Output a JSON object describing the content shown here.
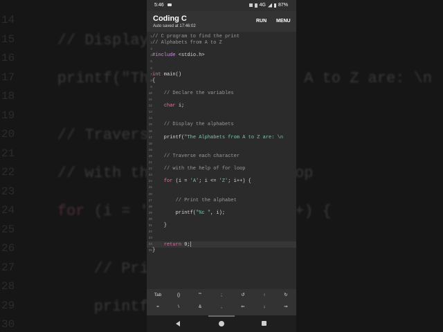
{
  "status_bar": {
    "time": "5:46",
    "network": "4G",
    "battery": "87%"
  },
  "app": {
    "title": "Coding C",
    "autosave": "Auto saved at 17:46:02",
    "run_label": "RUN",
    "menu_label": "MENU"
  },
  "editor": {
    "lines": [
      {
        "n": "1",
        "text": "// C program to find the print",
        "type": "comment"
      },
      {
        "n": "2",
        "text": "// Alphabets from A to Z",
        "type": "comment"
      },
      {
        "n": "3",
        "text": "",
        "type": "plain"
      },
      {
        "n": "4",
        "text": "#include <stdio.h>",
        "type": "include"
      },
      {
        "n": "5",
        "text": "",
        "type": "plain"
      },
      {
        "n": "6",
        "text": "",
        "type": "plain"
      },
      {
        "n": "7",
        "text": "int main()",
        "type": "main"
      },
      {
        "n": "8",
        "text": "{",
        "type": "plain"
      },
      {
        "n": "9",
        "text": "",
        "type": "plain"
      },
      {
        "n": "10",
        "text": "    // Declare the variables",
        "type": "comment"
      },
      {
        "n": "11",
        "text": "",
        "type": "plain"
      },
      {
        "n": "12",
        "text": "    char i;",
        "type": "decl"
      },
      {
        "n": "13",
        "text": "",
        "type": "plain"
      },
      {
        "n": "14",
        "text": "",
        "type": "plain"
      },
      {
        "n": "15",
        "text": "    // Display the alphabets",
        "type": "comment"
      },
      {
        "n": "16",
        "text": "",
        "type": "plain"
      },
      {
        "n": "17",
        "text": "    printf(\"The Alphabets from A to Z are: \\n",
        "type": "printf"
      },
      {
        "n": "18",
        "text": "",
        "type": "plain"
      },
      {
        "n": "19",
        "text": "",
        "type": "plain"
      },
      {
        "n": "20",
        "text": "    // Traverse each character",
        "type": "comment"
      },
      {
        "n": "21",
        "text": "",
        "type": "plain"
      },
      {
        "n": "22",
        "text": "    // with the help of for loop",
        "type": "comment"
      },
      {
        "n": "23",
        "text": "",
        "type": "plain"
      },
      {
        "n": "24",
        "text": "    for (i = 'A'; i <= 'Z'; i++) {",
        "type": "for"
      },
      {
        "n": "25",
        "text": "",
        "type": "plain"
      },
      {
        "n": "26",
        "text": "",
        "type": "plain"
      },
      {
        "n": "27",
        "text": "        // Print the alphabet",
        "type": "comment"
      },
      {
        "n": "28",
        "text": "",
        "type": "plain"
      },
      {
        "n": "29",
        "text": "        printf(\"%c \", i);",
        "type": "printf2"
      },
      {
        "n": "30",
        "text": "",
        "type": "plain"
      },
      {
        "n": "31",
        "text": "    }",
        "type": "plain"
      },
      {
        "n": "32",
        "text": "",
        "type": "plain"
      },
      {
        "n": "33",
        "text": "",
        "type": "plain"
      },
      {
        "n": "34",
        "text": "    return 0;",
        "type": "return"
      },
      {
        "n": "35",
        "text": "}",
        "type": "plain"
      }
    ],
    "active_line": "34"
  },
  "keys": [
    {
      "label": "Tab",
      "name": "key-tab"
    },
    {
      "label": "{}",
      "name": "key-braces"
    },
    {
      "label": "\"\"",
      "name": "key-quotes"
    },
    {
      "label": ";",
      "name": "key-semicolon"
    },
    {
      "label": "↺",
      "name": "key-undo"
    },
    {
      "label": "↑",
      "name": "key-up"
    },
    {
      "label": "↻",
      "name": "key-redo"
    },
    {
      "label": "=",
      "name": "key-equals"
    },
    {
      "label": "\\",
      "name": "key-backslash"
    },
    {
      "label": "&",
      "name": "key-ampersand"
    },
    {
      "label": ",",
      "name": "key-comma"
    },
    {
      "label": "⇐",
      "name": "key-left"
    },
    {
      "label": "↓",
      "name": "key-down"
    },
    {
      "label": "⇒",
      "name": "key-right"
    }
  ],
  "background": {
    "lines": [
      {
        "n": "14",
        "text": ""
      },
      {
        "n": "15",
        "text": "    // Display the alphabets"
      },
      {
        "n": "16",
        "text": ""
      },
      {
        "n": "17",
        "text": "    printf(\"The Alphabets from A to Z are: \\n"
      },
      {
        "n": "18",
        "text": ""
      },
      {
        "n": "19",
        "text": ""
      },
      {
        "n": "20",
        "text": "    // Traverse each character"
      },
      {
        "n": "21",
        "text": ""
      },
      {
        "n": "22",
        "text": "    // with the help of for loop"
      },
      {
        "n": "23",
        "text": ""
      },
      {
        "n": "24",
        "text": "    for (i = 'A'; i <= 'Z'; i++) {"
      },
      {
        "n": "25",
        "text": ""
      },
      {
        "n": "26",
        "text": ""
      },
      {
        "n": "27",
        "text": "        // Print the alphabet"
      },
      {
        "n": "28",
        "text": ""
      },
      {
        "n": "29",
        "text": "        printf(\"%c \", i);"
      },
      {
        "n": "30",
        "text": ""
      }
    ]
  },
  "colors": {
    "bg": "#2b2b2b",
    "keyword": "#d67ba3",
    "string": "#7fc4b0",
    "comment": "#9a9a9a",
    "caret": "#e0709f"
  }
}
